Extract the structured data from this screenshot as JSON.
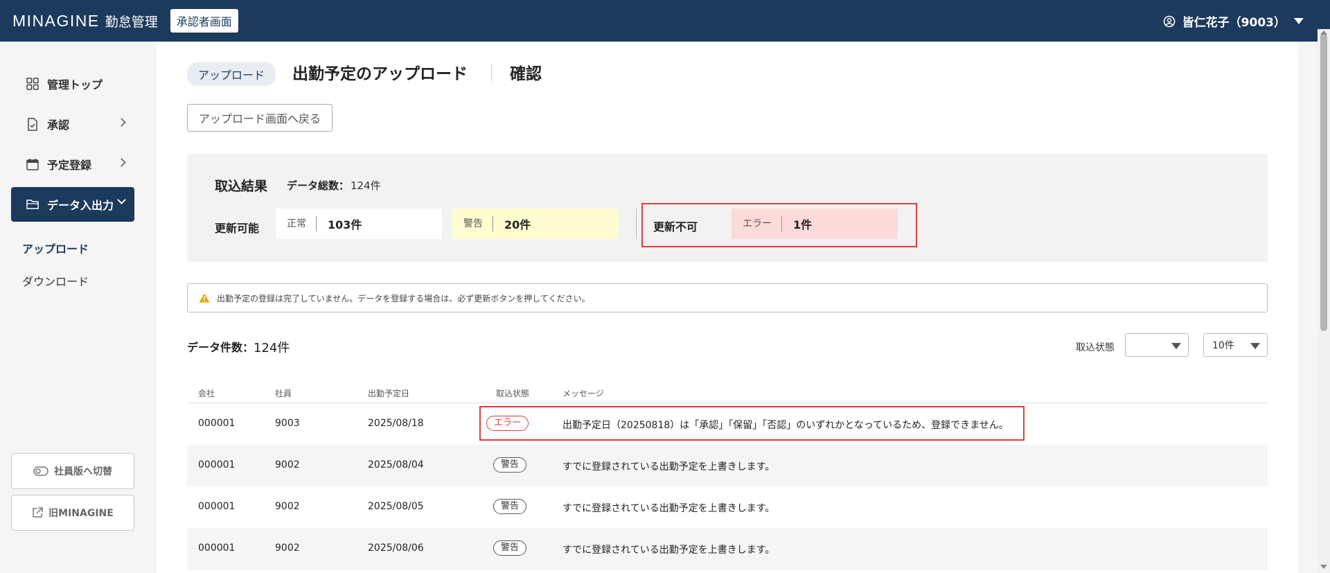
{
  "header": {
    "logo": "MINAGINE",
    "app_name": "勤怠管理",
    "role_badge": "承認者画面",
    "user_name": "皆仁花子（9003）"
  },
  "sidebar": {
    "items": [
      {
        "label": "管理トップ",
        "icon": "grid-icon"
      },
      {
        "label": "承認",
        "icon": "document-check-icon"
      },
      {
        "label": "予定登録",
        "icon": "calendar-icon"
      },
      {
        "label": "データ入出力",
        "icon": "folder-icon"
      }
    ],
    "sub_items": [
      {
        "label": "アップロード"
      },
      {
        "label": "ダウンロード"
      }
    ],
    "switch_button": "社員版へ切替",
    "old_button": "旧MINAGINE"
  },
  "page": {
    "crumb": "アップロード",
    "title": "出勤予定のアップロード",
    "subtitle": "確認",
    "back_button": "アップロード画面へ戻る"
  },
  "result": {
    "title": "取込結果",
    "total_label": "データ総数：",
    "total_value": "124件",
    "updatable_label": "更新可能",
    "normal_label": "正常",
    "normal_value": "103件",
    "warning_label": "警告",
    "warning_value": "20件",
    "not_updatable_label": "更新不可",
    "error_label": "エラー",
    "error_value": "1件"
  },
  "notice": {
    "text": "出勤予定の登録は完了していません。データを登録する場合は、必ず更新ボタンを押してください。"
  },
  "list": {
    "count_label": "データ件数：",
    "count_value": "124件",
    "filter_label": "取込状態",
    "filter_value": "",
    "per_page": "10件",
    "columns": [
      "会社",
      "社員",
      "出勤予定日",
      "取込状態",
      "メッセージ"
    ],
    "rows": [
      {
        "company": "000001",
        "employee": "9003",
        "date": "2025/08/18",
        "status": "エラー",
        "message": "出勤予定日（20250818）は「承認」「保留」「否認」のいずれかとなっているため、登録できません。"
      },
      {
        "company": "000001",
        "employee": "9002",
        "date": "2025/08/04",
        "status": "警告",
        "message": "すでに登録されている出勤予定を上書きします。"
      },
      {
        "company": "000001",
        "employee": "9002",
        "date": "2025/08/05",
        "status": "警告",
        "message": "すでに登録されている出勤予定を上書きします。"
      },
      {
        "company": "000001",
        "employee": "9002",
        "date": "2025/08/06",
        "status": "警告",
        "message": "すでに登録されている出勤予定を上書きします。"
      }
    ]
  },
  "colors": {
    "brand": "#1b3a5c",
    "error": "#e23b3b",
    "warning_bg": "#fdfdcf",
    "error_bg": "#fddada"
  }
}
